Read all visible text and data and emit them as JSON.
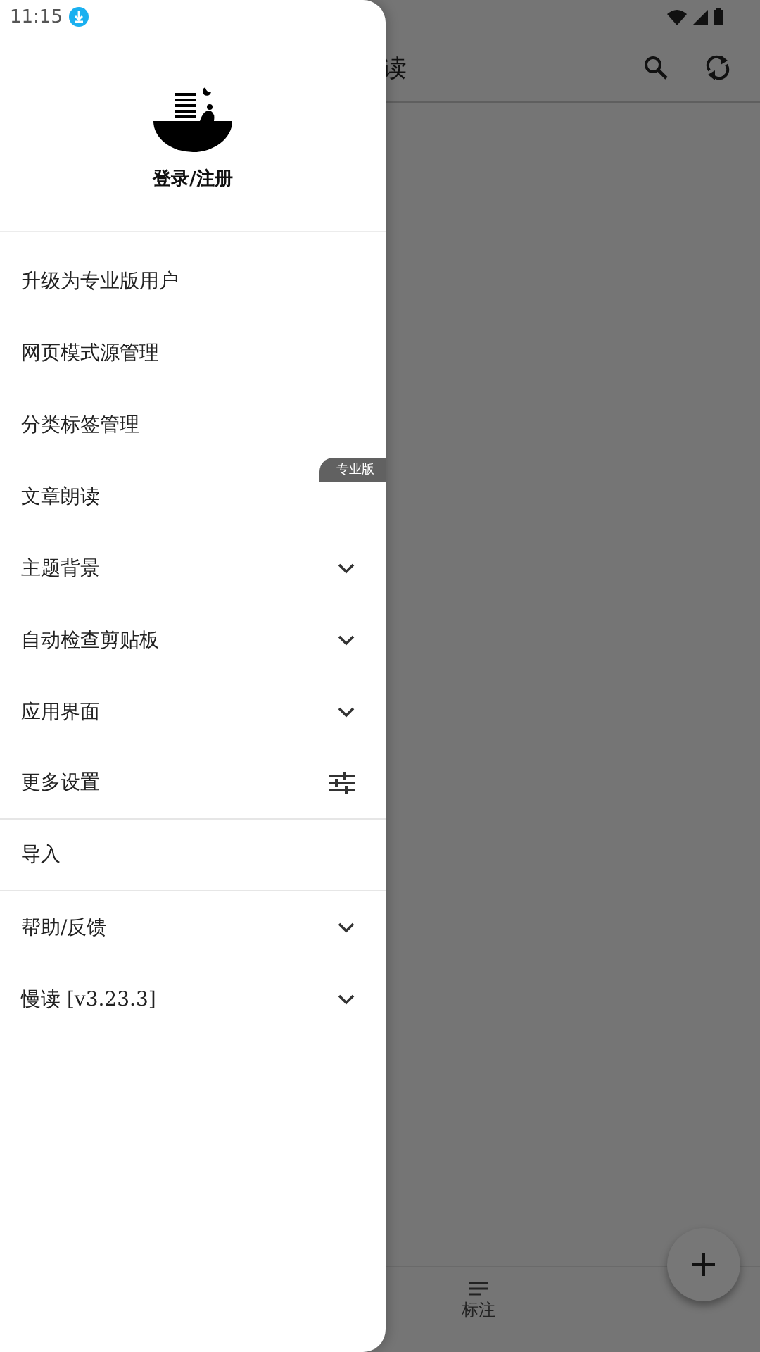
{
  "status_bar": {
    "time": "11:15"
  },
  "toolbar": {
    "title": "读"
  },
  "bottom_nav": {
    "label": "标注"
  },
  "drawer": {
    "account": {
      "label": "登录/注册"
    },
    "items": [
      {
        "kind": "plain",
        "label": "升级为专业版用户"
      },
      {
        "kind": "plain",
        "label": "网页模式源管理"
      },
      {
        "kind": "plain",
        "label": "分类标签管理"
      },
      {
        "kind": "plain",
        "label": "文章朗读",
        "badge": "专业版"
      },
      {
        "kind": "expandable",
        "label": "主题背景",
        "expanded": false
      },
      {
        "kind": "expandable",
        "label": "自动检查剪贴板",
        "expanded": false
      },
      {
        "kind": "expandable",
        "label": "应用界面",
        "expanded": false
      },
      {
        "kind": "settings",
        "label": "更多设置",
        "divider_after": true
      },
      {
        "kind": "plain",
        "label": "导入",
        "divider_after": true
      },
      {
        "kind": "expandable",
        "label": "帮助/反馈",
        "expanded": false
      },
      {
        "kind": "expandable",
        "label": "慢读 [v3.23.3]",
        "expanded": false
      }
    ]
  }
}
